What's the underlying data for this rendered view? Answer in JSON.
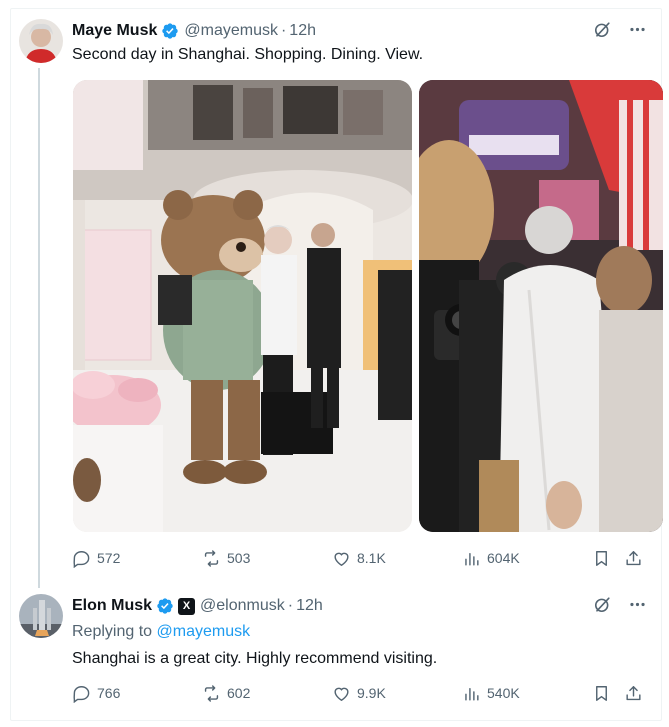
{
  "colors": {
    "text": "#0f1419",
    "muted": "#536471",
    "link": "#1d9bf0",
    "verified": "#1d9bf0",
    "thread_line": "#cfd9de"
  },
  "tweet": {
    "author_name": "Maye Musk",
    "author_handle": "@mayemusk",
    "separator": "·",
    "time": "12h",
    "text": "Second day in Shanghai. Shopping. Dining. View.",
    "photos": [
      {
        "icon": "photo-teddy-bear-store"
      },
      {
        "icon": "photo-crowd-photographer"
      }
    ],
    "stats": {
      "replies": "572",
      "reposts": "503",
      "likes": "8.1K",
      "views": "604K"
    }
  },
  "reply": {
    "author_name": "Elon Musk",
    "author_handle": "@elonmusk",
    "separator": "·",
    "time": "12h",
    "affiliate_badge": "X",
    "replying_prefix": "Replying to",
    "replying_handle": "@mayemusk",
    "text": "Shanghai is a great city. Highly recommend visiting.",
    "stats": {
      "replies": "766",
      "reposts": "602",
      "likes": "9.9K",
      "views": "540K"
    }
  },
  "icons": [
    "verified-icon",
    "grok-icon",
    "more-icon",
    "reply-icon",
    "repost-icon",
    "like-icon",
    "views-icon",
    "bookmark-icon",
    "share-icon"
  ]
}
